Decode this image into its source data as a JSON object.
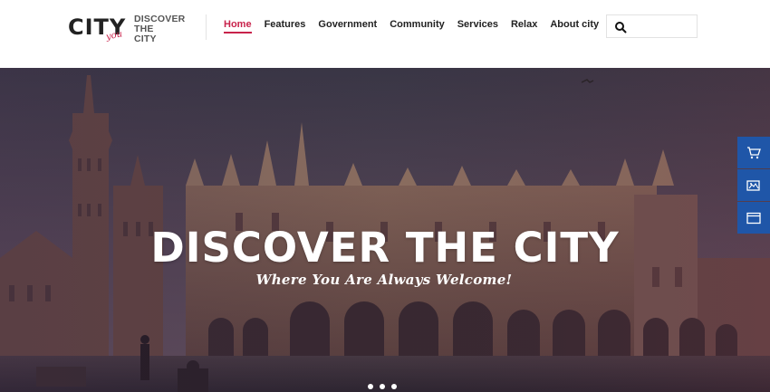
{
  "logo": {
    "brand": "CITY",
    "brand_accent": "you",
    "tagline": [
      "DISCOVER",
      "THE",
      "CITY"
    ]
  },
  "nav": {
    "items": [
      {
        "label": "Home",
        "active": true
      },
      {
        "label": "Features",
        "active": false
      },
      {
        "label": "Government",
        "active": false
      },
      {
        "label": "Community",
        "active": false
      },
      {
        "label": "Services",
        "active": false
      },
      {
        "label": "Relax",
        "active": false
      },
      {
        "label": "About city",
        "active": false
      }
    ]
  },
  "search": {
    "placeholder": "",
    "icon": "search-icon"
  },
  "hero": {
    "title": "DISCOVER THE CITY",
    "subtitle": "Where You Are Always Welcome!",
    "slides": 3,
    "active_slide": 1
  },
  "side_widgets": [
    {
      "icon": "cart-icon"
    },
    {
      "icon": "image-icon"
    },
    {
      "icon": "window-icon"
    }
  ],
  "colors": {
    "accent": "#c8234b",
    "side_widget": "#1f56a8",
    "text": "#222222"
  }
}
